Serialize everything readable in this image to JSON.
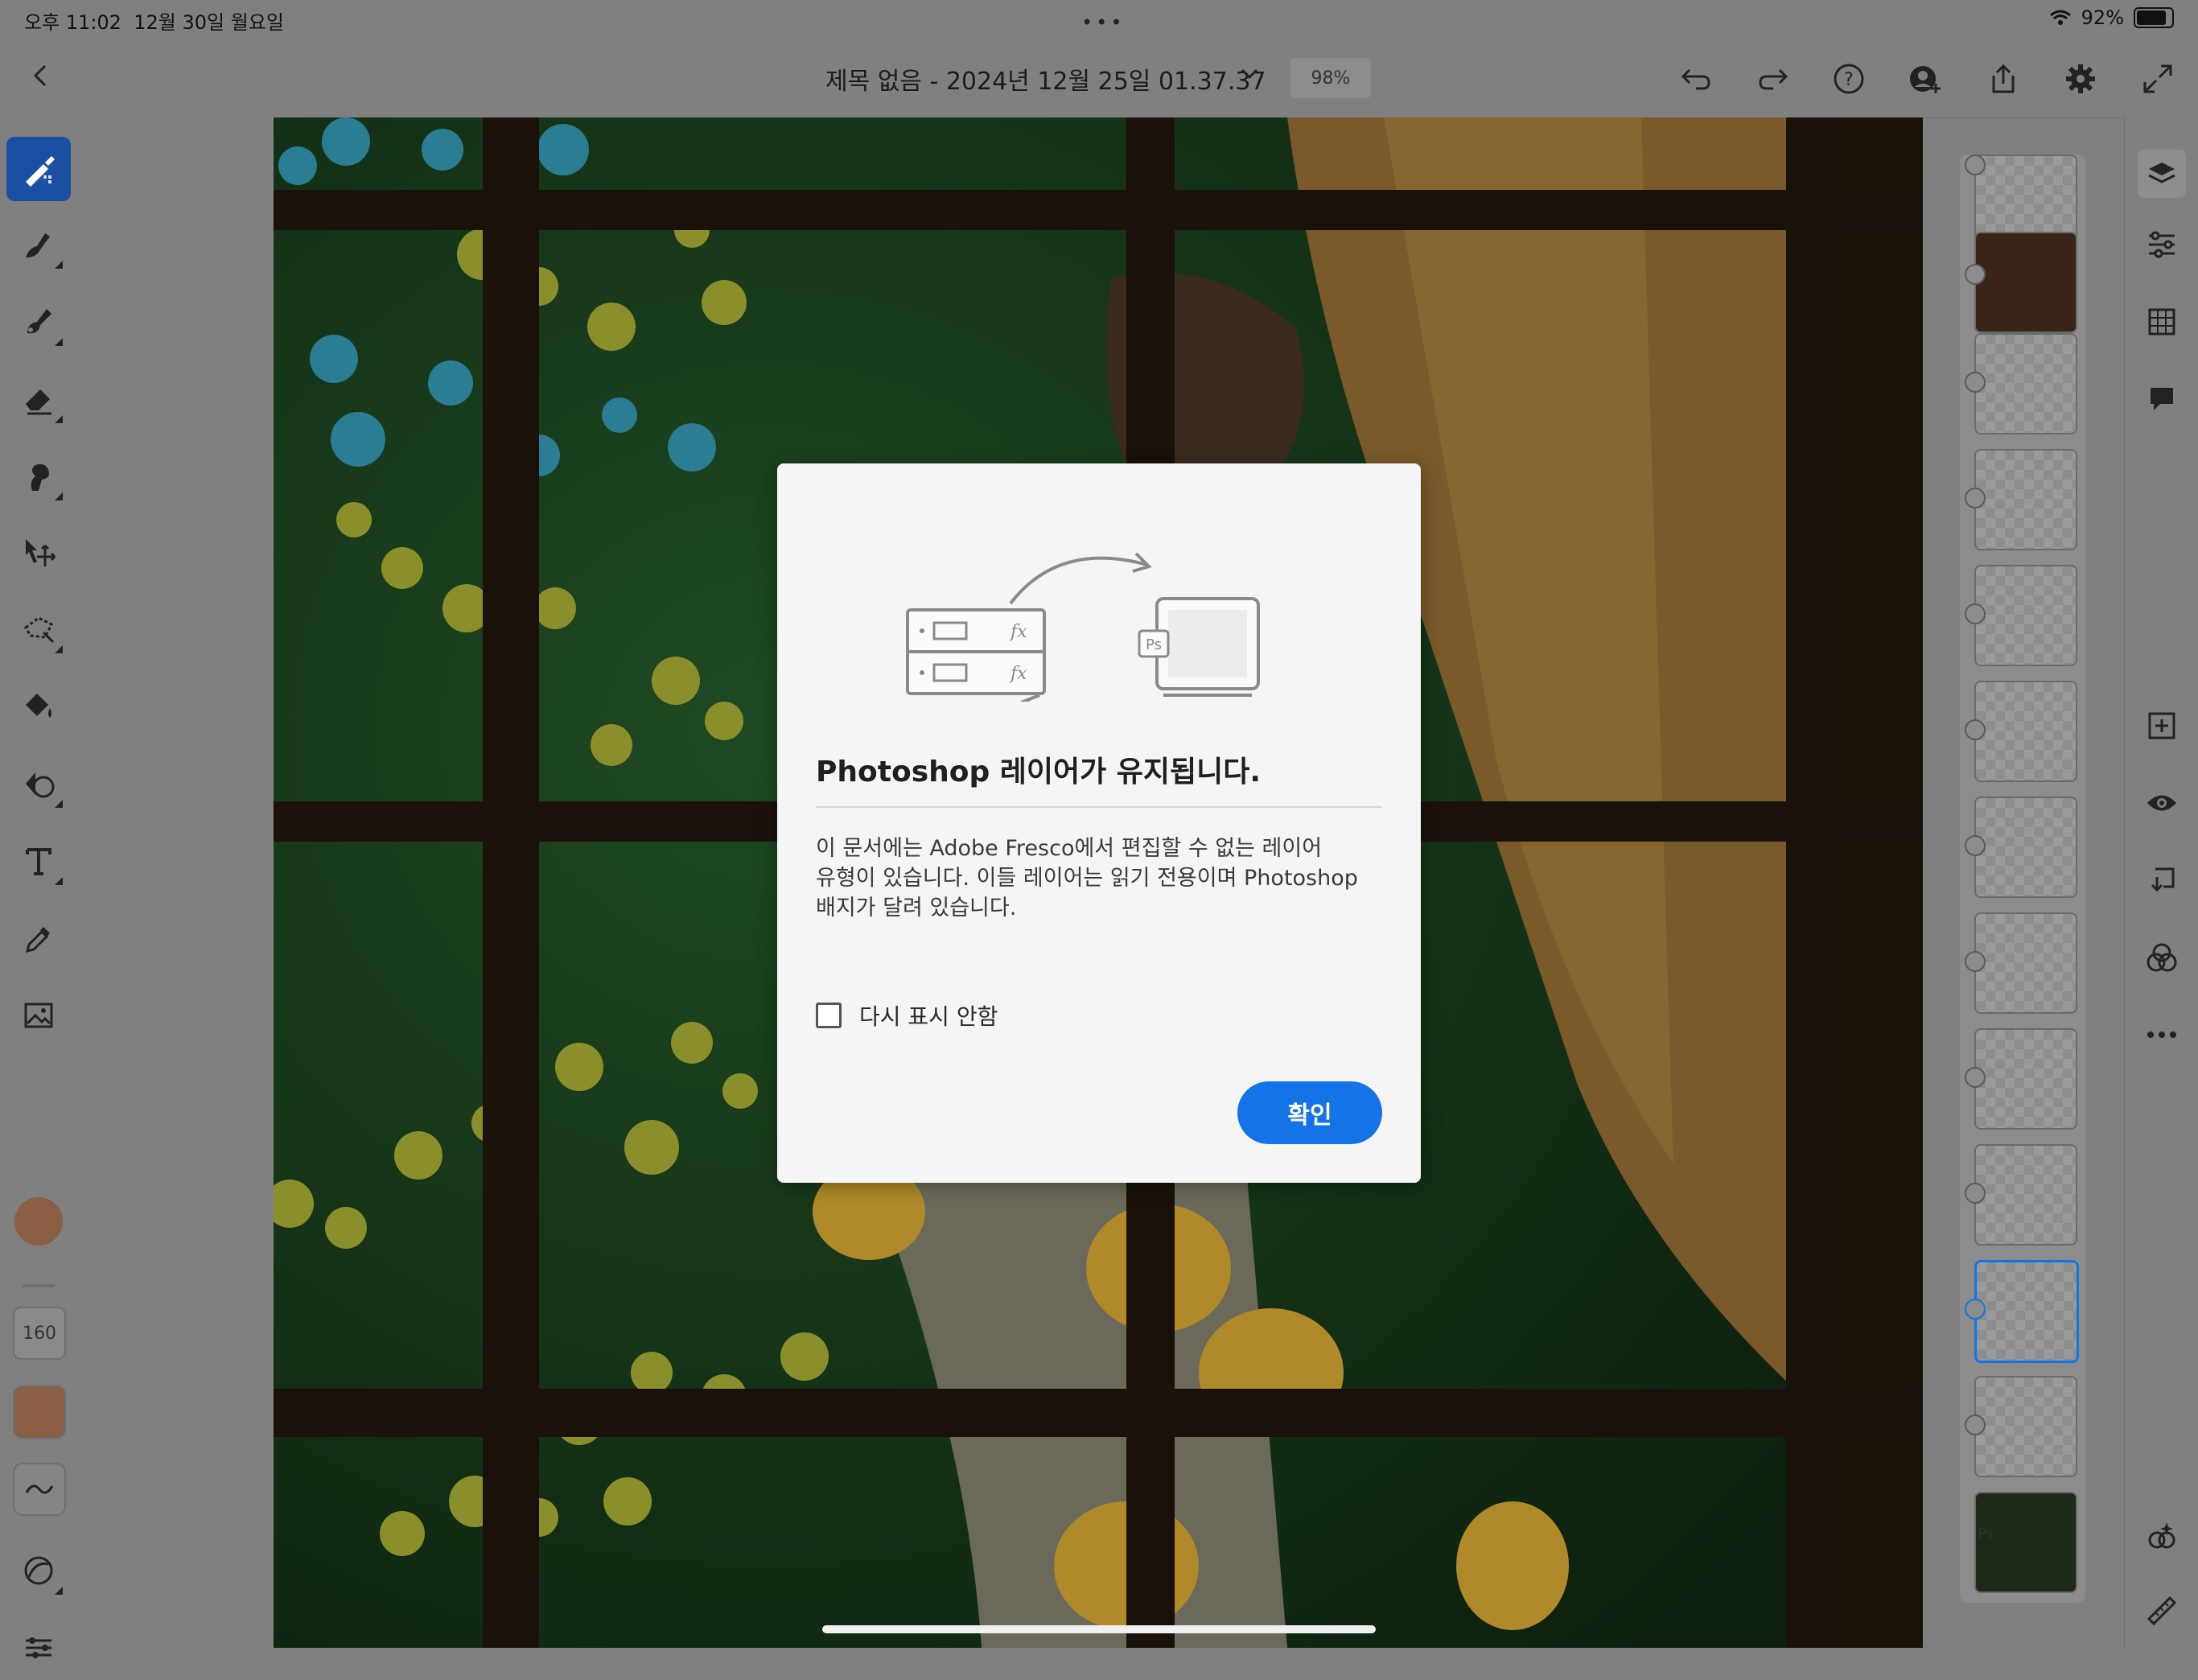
{
  "status_bar": {
    "time": "오후 11:02",
    "date": "12월 30일 월요일",
    "battery_percent": "92%"
  },
  "top_bar": {
    "document_title": "제목 없음 - 2024년 12월 25일 01.37.37",
    "zoom_level": "98%",
    "icons": [
      "back-icon",
      "undo-icon",
      "redo-icon",
      "help-icon",
      "share-user-icon",
      "export-icon",
      "settings-icon",
      "fullscreen-icon"
    ]
  },
  "left_tools": {
    "brush_size": "160",
    "tools": [
      "pixel-brush",
      "live-brush",
      "vector-brush",
      "eraser",
      "smudge",
      "move",
      "lasso-select",
      "fill",
      "shapes",
      "type",
      "eyedropper",
      "image"
    ]
  },
  "layers_panel": {
    "layer_count": 13,
    "selected_index": 10,
    "badge": "Ps"
  },
  "right_bar": {
    "icons": [
      "layers-icon",
      "adjustments-icon",
      "grid-icon",
      "comment-icon",
      "add-layer-icon",
      "visibility-icon",
      "merge-down-icon",
      "blend-icon",
      "more-icon",
      "wand-icon",
      "ruler-icon"
    ]
  },
  "dialog": {
    "title": "Photoshop 레이어가 유지됩니다.",
    "body_line1": "이 문서에는 Adobe Fresco에서 편집할 수 없는 레이어",
    "body_line2": "유형이 있습니다. 이들 레이어는 읽기 전용이며 Photoshop",
    "body_line3": "배지가 달려 있습니다.",
    "checkbox_label": "다시 표시 안함",
    "checkbox_checked": false,
    "confirm_label": "확인",
    "illustration": {
      "fx1": "fx",
      "fx2": "fx",
      "ps_badge": "Ps"
    }
  },
  "colors": {
    "accent": "#1473e6",
    "active_tool": "#1b4fa3",
    "current_color": "#8a5f43"
  }
}
